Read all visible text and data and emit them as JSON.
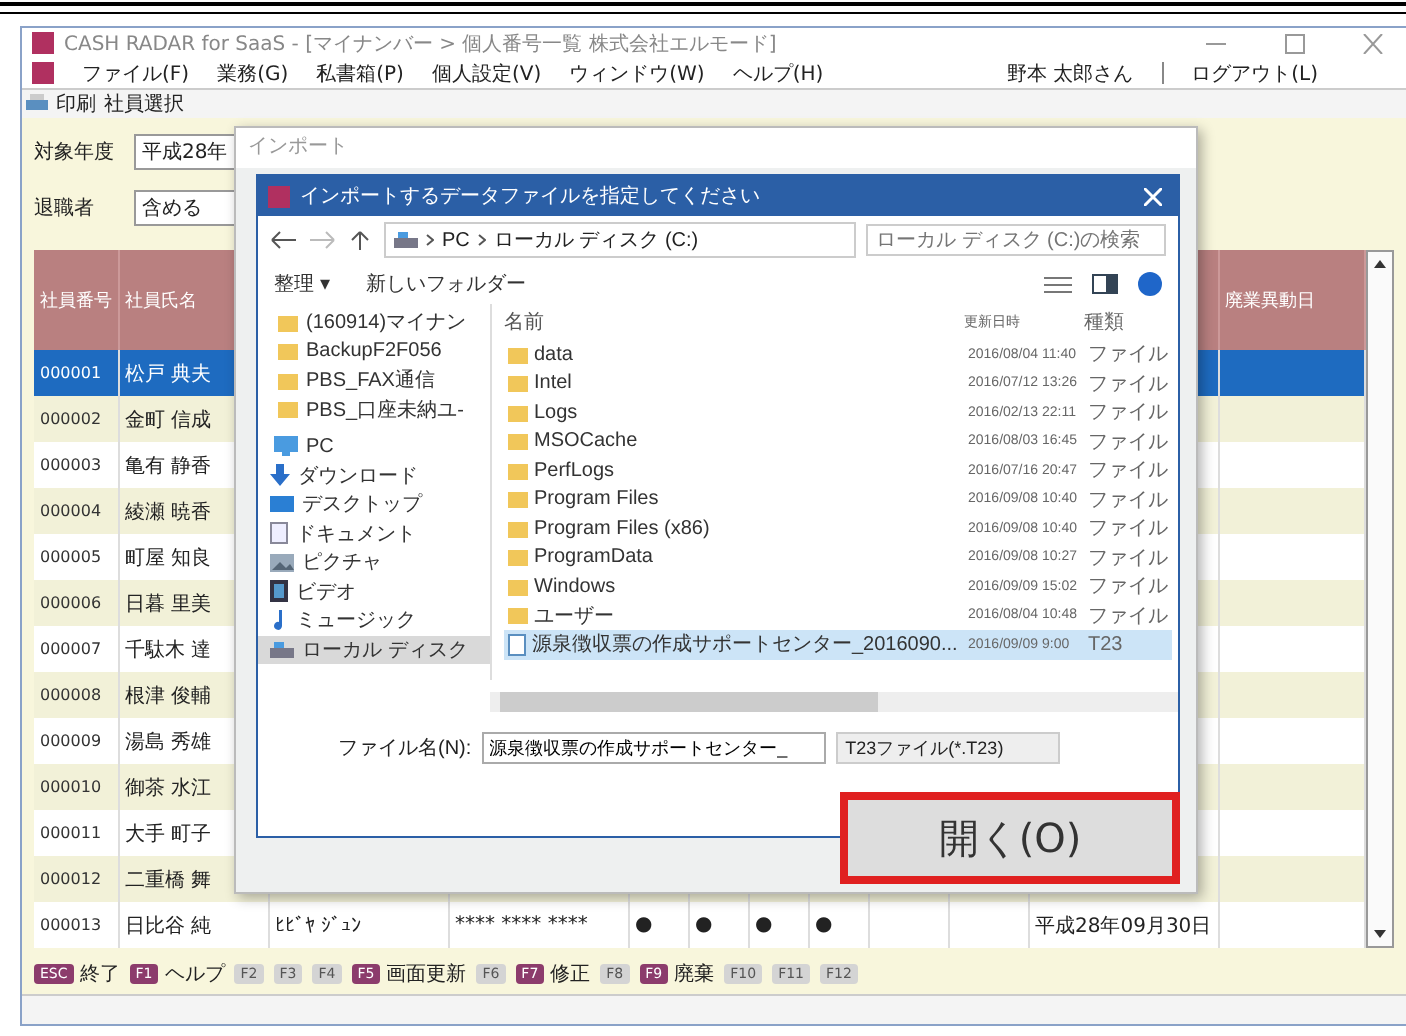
{
  "window": {
    "title": "CASH RADAR for SaaS - [マイナンバー > 個人番号一覧 株式会社エルモード]"
  },
  "menu": [
    "ファイル(F)",
    "業務(G)",
    "私書箱(P)",
    "個人設定(V)",
    "ウィンドウ(W)",
    "ヘルプ(H)"
  ],
  "user": {
    "name": "野本 太郎さん",
    "logout": "ログアウト(L)"
  },
  "toolbar": [
    "印刷",
    "社員選択"
  ],
  "filters": [
    {
      "label": "対象年度",
      "value": "平成28年"
    },
    {
      "label": "退職者",
      "value": "含める"
    }
  ],
  "table": {
    "columns": [
      {
        "label": "社員番号"
      },
      {
        "label": "社員氏名"
      },
      {},
      {},
      {},
      {},
      {},
      {},
      {},
      {},
      {},
      {
        "label": "廃業異動日"
      }
    ],
    "rows": [
      {
        "selected": true,
        "cells": [
          "000001",
          "松戸 典夫"
        ]
      },
      {
        "selected": false,
        "cells": [
          "000002",
          "金町 信成"
        ]
      },
      {
        "selected": false,
        "cells": [
          "000003",
          "亀有 静香"
        ]
      },
      {
        "selected": false,
        "cells": [
          "000004",
          "綾瀬 暁香"
        ]
      },
      {
        "selected": false,
        "cells": [
          "000005",
          "町屋 知良"
        ]
      },
      {
        "selected": false,
        "cells": [
          "000006",
          "日暮 里美"
        ]
      },
      {
        "selected": false,
        "cells": [
          "000007",
          "千駄木 達"
        ]
      },
      {
        "selected": false,
        "cells": [
          "000008",
          "根津 俊輔"
        ]
      },
      {
        "selected": false,
        "cells": [
          "000009",
          "湯島 秀雄"
        ]
      },
      {
        "selected": false,
        "cells": [
          "000010",
          "御茶 水江"
        ]
      },
      {
        "selected": false,
        "cells": [
          "000011",
          "大手 町子"
        ]
      },
      {
        "selected": false,
        "cells": [
          "000012",
          "二重橋 舞"
        ]
      },
      {
        "selected": false,
        "cells": [
          "000013",
          "日比谷 純",
          "ﾋﾋﾞﾔ ｼﾞｭﾝ",
          "**** **** ****",
          "●",
          "●",
          "●",
          "●",
          "",
          "",
          "平成28年09月30日"
        ]
      }
    ]
  },
  "import_dialog": {
    "title": "インポート"
  },
  "file_dialog": {
    "title": "インポートするデータファイルを指定してください",
    "path": [
      "PC",
      "ローカル ディスク (C:)"
    ],
    "search": {
      "placeholder": "ローカル ディスク (C:)の検索"
    },
    "commands": [
      "整理 ▾",
      "新しいフォルダー"
    ],
    "nav": [
      {
        "label": "(160914)マイナン",
        "kind": "folder",
        "selected": false
      },
      {
        "label": "BackupF2F056",
        "kind": "folder",
        "selected": false
      },
      {
        "label": "PBS_FAX通信",
        "kind": "folder",
        "selected": false
      },
      {
        "label": "PBS_口座未納ユ-",
        "kind": "folder",
        "selected": false
      },
      {
        "label": "PC",
        "kind": "pc",
        "selected": false
      },
      {
        "label": "ダウンロード",
        "kind": "download",
        "selected": false
      },
      {
        "label": "デスクトップ",
        "kind": "desktop",
        "selected": false
      },
      {
        "label": "ドキュメント",
        "kind": "document",
        "selected": false
      },
      {
        "label": "ピクチャ",
        "kind": "picture",
        "selected": false
      },
      {
        "label": "ビデオ",
        "kind": "video",
        "selected": false
      },
      {
        "label": "ミュージック",
        "kind": "music",
        "selected": false
      },
      {
        "label": "ローカル ディスク",
        "kind": "drive",
        "selected": true
      }
    ],
    "columns": [
      "名前",
      "更新日時",
      "種類"
    ],
    "files": [
      {
        "name": "data",
        "date": "2016/08/04 11:40",
        "type": "ファイル",
        "kind": "folder",
        "selected": false
      },
      {
        "name": "Intel",
        "date": "2016/07/12 13:26",
        "type": "ファイル",
        "kind": "folder",
        "selected": false
      },
      {
        "name": "Logs",
        "date": "2016/02/13 22:11",
        "type": "ファイル",
        "kind": "folder",
        "selected": false
      },
      {
        "name": "MSOCache",
        "date": "2016/08/03 16:45",
        "type": "ファイル",
        "kind": "folder",
        "selected": false
      },
      {
        "name": "PerfLogs",
        "date": "2016/07/16 20:47",
        "type": "ファイル",
        "kind": "folder",
        "selected": false
      },
      {
        "name": "Program Files",
        "date": "2016/09/08 10:40",
        "type": "ファイル",
        "kind": "folder",
        "selected": false
      },
      {
        "name": "Program Files (x86)",
        "date": "2016/09/08 10:40",
        "type": "ファイル",
        "kind": "folder",
        "selected": false
      },
      {
        "name": "ProgramData",
        "date": "2016/09/08 10:27",
        "type": "ファイル",
        "kind": "folder",
        "selected": false
      },
      {
        "name": "Windows",
        "date": "2016/09/09 15:02",
        "type": "ファイル",
        "kind": "folder",
        "selected": false
      },
      {
        "name": "ユーザー",
        "date": "2016/08/04 10:48",
        "type": "ファイル",
        "kind": "folder",
        "selected": false
      },
      {
        "name": "源泉徴収票の作成サポートセンター_2016090...",
        "date": "2016/09/09 9:00",
        "type": "T23",
        "kind": "file",
        "selected": true
      }
    ],
    "filename_label": "ファイル名(N):",
    "filename": "源泉徴収票の作成サポートセンター_",
    "filetype": "T23ファイル(*.T23)",
    "open_button": "開く(O)"
  },
  "function_keys": [
    {
      "key": "ESC",
      "label": "終了",
      "enabled": true
    },
    {
      "key": "F1",
      "label": "ヘルプ",
      "enabled": true
    },
    {
      "key": "F2",
      "enabled": false
    },
    {
      "key": "F3",
      "enabled": false
    },
    {
      "key": "F4",
      "enabled": false
    },
    {
      "key": "F5",
      "label": "画面更新",
      "enabled": true
    },
    {
      "key": "F6",
      "enabled": false
    },
    {
      "key": "F7",
      "label": "修正",
      "enabled": true
    },
    {
      "key": "F8",
      "enabled": false
    },
    {
      "key": "F9",
      "label": "廃棄",
      "enabled": true
    },
    {
      "key": "F10",
      "enabled": false
    },
    {
      "key": "F11",
      "enabled": false
    },
    {
      "key": "F12",
      "enabled": false
    }
  ]
}
